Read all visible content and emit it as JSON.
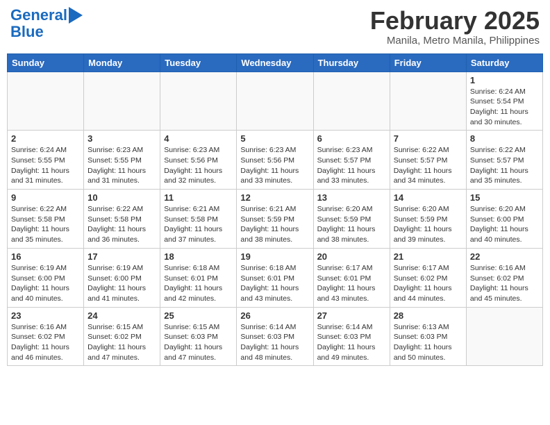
{
  "header": {
    "logo_line1": "General",
    "logo_line2": "Blue",
    "month": "February 2025",
    "location": "Manila, Metro Manila, Philippines"
  },
  "weekdays": [
    "Sunday",
    "Monday",
    "Tuesday",
    "Wednesday",
    "Thursday",
    "Friday",
    "Saturday"
  ],
  "weeks": [
    [
      {
        "day": "",
        "info": ""
      },
      {
        "day": "",
        "info": ""
      },
      {
        "day": "",
        "info": ""
      },
      {
        "day": "",
        "info": ""
      },
      {
        "day": "",
        "info": ""
      },
      {
        "day": "",
        "info": ""
      },
      {
        "day": "1",
        "info": "Sunrise: 6:24 AM\nSunset: 5:54 PM\nDaylight: 11 hours\nand 30 minutes."
      }
    ],
    [
      {
        "day": "2",
        "info": "Sunrise: 6:24 AM\nSunset: 5:55 PM\nDaylight: 11 hours\nand 31 minutes."
      },
      {
        "day": "3",
        "info": "Sunrise: 6:23 AM\nSunset: 5:55 PM\nDaylight: 11 hours\nand 31 minutes."
      },
      {
        "day": "4",
        "info": "Sunrise: 6:23 AM\nSunset: 5:56 PM\nDaylight: 11 hours\nand 32 minutes."
      },
      {
        "day": "5",
        "info": "Sunrise: 6:23 AM\nSunset: 5:56 PM\nDaylight: 11 hours\nand 33 minutes."
      },
      {
        "day": "6",
        "info": "Sunrise: 6:23 AM\nSunset: 5:57 PM\nDaylight: 11 hours\nand 33 minutes."
      },
      {
        "day": "7",
        "info": "Sunrise: 6:22 AM\nSunset: 5:57 PM\nDaylight: 11 hours\nand 34 minutes."
      },
      {
        "day": "8",
        "info": "Sunrise: 6:22 AM\nSunset: 5:57 PM\nDaylight: 11 hours\nand 35 minutes."
      }
    ],
    [
      {
        "day": "9",
        "info": "Sunrise: 6:22 AM\nSunset: 5:58 PM\nDaylight: 11 hours\nand 35 minutes."
      },
      {
        "day": "10",
        "info": "Sunrise: 6:22 AM\nSunset: 5:58 PM\nDaylight: 11 hours\nand 36 minutes."
      },
      {
        "day": "11",
        "info": "Sunrise: 6:21 AM\nSunset: 5:58 PM\nDaylight: 11 hours\nand 37 minutes."
      },
      {
        "day": "12",
        "info": "Sunrise: 6:21 AM\nSunset: 5:59 PM\nDaylight: 11 hours\nand 38 minutes."
      },
      {
        "day": "13",
        "info": "Sunrise: 6:20 AM\nSunset: 5:59 PM\nDaylight: 11 hours\nand 38 minutes."
      },
      {
        "day": "14",
        "info": "Sunrise: 6:20 AM\nSunset: 5:59 PM\nDaylight: 11 hours\nand 39 minutes."
      },
      {
        "day": "15",
        "info": "Sunrise: 6:20 AM\nSunset: 6:00 PM\nDaylight: 11 hours\nand 40 minutes."
      }
    ],
    [
      {
        "day": "16",
        "info": "Sunrise: 6:19 AM\nSunset: 6:00 PM\nDaylight: 11 hours\nand 40 minutes."
      },
      {
        "day": "17",
        "info": "Sunrise: 6:19 AM\nSunset: 6:00 PM\nDaylight: 11 hours\nand 41 minutes."
      },
      {
        "day": "18",
        "info": "Sunrise: 6:18 AM\nSunset: 6:01 PM\nDaylight: 11 hours\nand 42 minutes."
      },
      {
        "day": "19",
        "info": "Sunrise: 6:18 AM\nSunset: 6:01 PM\nDaylight: 11 hours\nand 43 minutes."
      },
      {
        "day": "20",
        "info": "Sunrise: 6:17 AM\nSunset: 6:01 PM\nDaylight: 11 hours\nand 43 minutes."
      },
      {
        "day": "21",
        "info": "Sunrise: 6:17 AM\nSunset: 6:02 PM\nDaylight: 11 hours\nand 44 minutes."
      },
      {
        "day": "22",
        "info": "Sunrise: 6:16 AM\nSunset: 6:02 PM\nDaylight: 11 hours\nand 45 minutes."
      }
    ],
    [
      {
        "day": "23",
        "info": "Sunrise: 6:16 AM\nSunset: 6:02 PM\nDaylight: 11 hours\nand 46 minutes."
      },
      {
        "day": "24",
        "info": "Sunrise: 6:15 AM\nSunset: 6:02 PM\nDaylight: 11 hours\nand 47 minutes."
      },
      {
        "day": "25",
        "info": "Sunrise: 6:15 AM\nSunset: 6:03 PM\nDaylight: 11 hours\nand 47 minutes."
      },
      {
        "day": "26",
        "info": "Sunrise: 6:14 AM\nSunset: 6:03 PM\nDaylight: 11 hours\nand 48 minutes."
      },
      {
        "day": "27",
        "info": "Sunrise: 6:14 AM\nSunset: 6:03 PM\nDaylight: 11 hours\nand 49 minutes."
      },
      {
        "day": "28",
        "info": "Sunrise: 6:13 AM\nSunset: 6:03 PM\nDaylight: 11 hours\nand 50 minutes."
      },
      {
        "day": "",
        "info": ""
      }
    ]
  ]
}
